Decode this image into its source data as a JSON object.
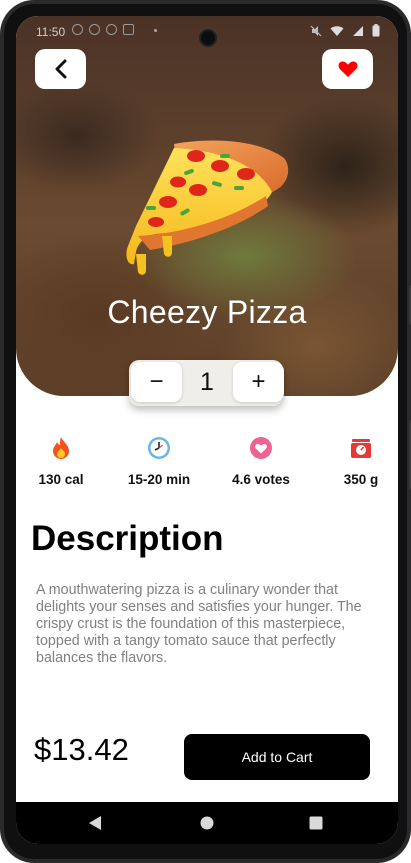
{
  "status_bar": {
    "time": "11:50"
  },
  "product": {
    "title": "Cheezy Pizza",
    "quantity": "1",
    "minus_label": "−",
    "plus_label": "+"
  },
  "stats": [
    {
      "icon": "flame-icon",
      "label": "130 cal"
    },
    {
      "icon": "clock-icon",
      "label": "15-20 min"
    },
    {
      "icon": "heart-badge-icon",
      "label": "4.6 votes"
    },
    {
      "icon": "scale-icon",
      "label": "350 g"
    }
  ],
  "description": {
    "heading": "Description",
    "text": "A mouthwatering pizza is a culinary wonder that delights your senses and satisfies your hunger. The crispy crust is the foundation of this masterpiece, topped with a tangy tomato sauce that perfectly balances the flavors."
  },
  "footer": {
    "price": "$13.42",
    "add_to_cart": "Add to Cart"
  },
  "colors": {
    "accent": "#000000",
    "favorite": "#ff0000",
    "muted_text": "#808080"
  }
}
